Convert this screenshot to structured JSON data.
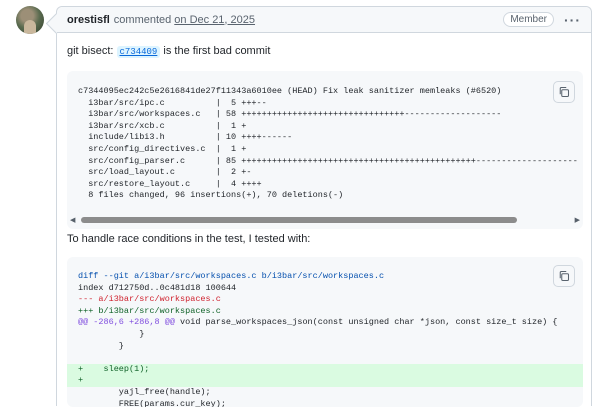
{
  "comment": {
    "author": "orestisfl",
    "verb": "commented",
    "date": "on Dec 21, 2025",
    "role_badge": "Member",
    "menu_icon": "kebab-horizontal-icon"
  },
  "body": {
    "para1_prefix": "git bisect:",
    "commit_ref": "c734409",
    "para1_suffix": "is the first bad commit",
    "para2": "To handle race conditions in the test, I tested with:"
  },
  "code_block_1": {
    "lines": [
      "c7344095ec242c5e2616841de27f11343a6010ee (HEAD) Fix leak sanitizer memleaks (#6520)",
      "  i3bar/src/ipc.c          |  5 +++--",
      "  i3bar/src/workspaces.c   | 58 ++++++++++++++++++++++++++++++++-------------------",
      "  i3bar/src/xcb.c          |  1 +",
      "  include/libi3.h          | 10 ++++------",
      "  src/config_directives.c  |  1 +",
      "  src/config_parser.c      | 85 ++++++++++++++++++++++++++++++++++++++++++++++--------------------",
      "  src/load_layout.c        |  2 +-",
      "  src/restore_layout.c     |  4 ++++",
      "  8 files changed, 96 insertions(+), 70 deletions(-)"
    ]
  },
  "code_block_2": {
    "diff_header": "diff --git a/i3bar/src/workspaces.c b/i3bar/src/workspaces.c",
    "index_line": "index d712750d..0c481d18 100644",
    "minus_file": "--- a/i3bar/src/workspaces.c",
    "plus_file": "+++ b/i3bar/src/workspaces.c",
    "hunk_marker": "@@ -286,6 +286,8 @@",
    "hunk_context": " void parse_workspaces_json(const unsigned char *json, const size_t size) {",
    "ctx1": "            }",
    "ctx2": "        }",
    "ctx3": "",
    "add1": "+    sleep(1);",
    "add2": "+",
    "ctx4": "        yajl_free(handle);",
    "ctx5": "        FREE(params.cur_key);"
  },
  "icons": {
    "copy": "copy-icon",
    "scroll_left": "chevron-left-icon",
    "scroll_right": "chevron-right-icon"
  },
  "colors": {
    "link": "#0969da",
    "border": "#d0d7de",
    "header_bg": "#f6f8fa",
    "diff_del": "#cf222e",
    "diff_add": "#116329",
    "diff_add_bg": "#dafbe1",
    "diff_hunk": "#8250df"
  }
}
